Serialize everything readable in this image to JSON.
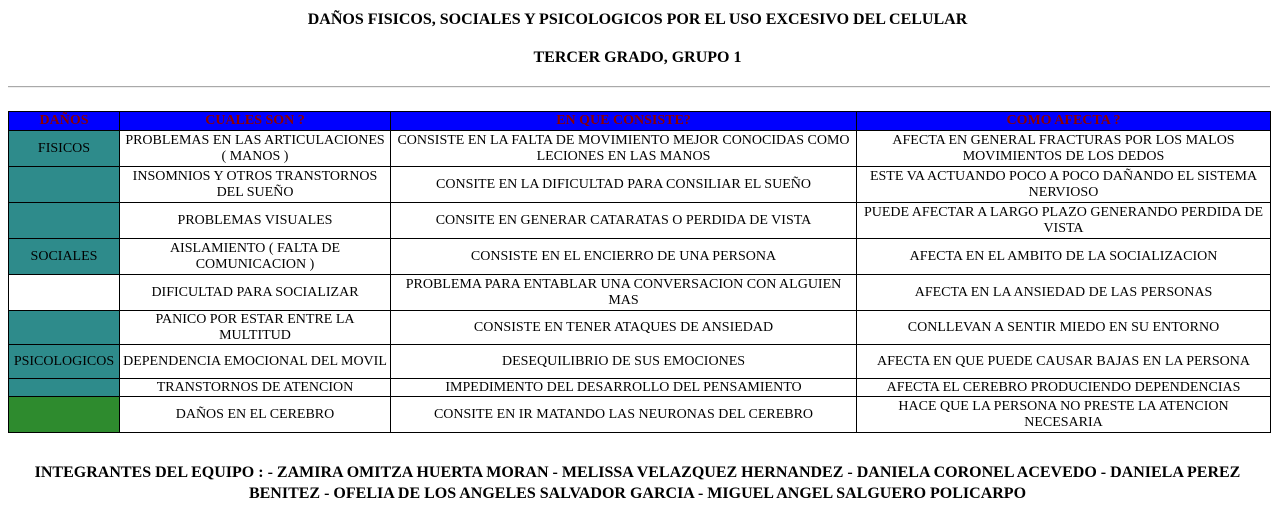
{
  "title": "DAÑOS FISICOS, SOCIALES Y PSICOLOGICOS POR EL USO EXCESIVO DEL CELULAR",
  "subtitle": "TERCER GRADO, GRUPO 1",
  "colors": {
    "header_bg": "#0000ff",
    "header_text": "#8b0000",
    "teal": "#2e8b8b",
    "green": "#2e8b2e",
    "white": "#ffffff"
  },
  "table": {
    "headers": [
      "DAÑOS",
      "CUALES SON ?",
      "EN QUE CONSISTE?",
      "COMO AFECTA ?"
    ],
    "rows": [
      {
        "category": "FISICOS",
        "cat_color": "teal",
        "cual": "PROBLEMAS EN LAS ARTICULACIONES ( MANOS )",
        "consiste": "CONSISTE EN LA FALTA DE MOVIMIENTO MEJOR CONOCIDAS COMO LECIONES EN LAS MANOS",
        "afecta": "AFECTA EN GENERAL FRACTURAS POR LOS MALOS MOVIMIENTOS DE LOS DEDOS"
      },
      {
        "category": "",
        "cat_color": "teal",
        "cual": "INSOMNIOS Y OTROS TRANSTORNOS DEL SUEÑO",
        "consiste": "CONSITE EN LA DIFICULTAD PARA CONSILIAR EL SUEÑO",
        "afecta": "ESTE VA ACTUANDO POCO A POCO DAÑANDO EL SISTEMA NERVIOSO"
      },
      {
        "category": "",
        "cat_color": "teal",
        "cual": "PROBLEMAS VISUALES",
        "consiste": "CONSITE EN GENERAR CATARATAS O PERDIDA DE VISTA",
        "afecta": "PUEDE AFECTAR A LARGO PLAZO GENERANDO PERDIDA DE VISTA"
      },
      {
        "category": "SOCIALES",
        "cat_color": "teal",
        "cual": "AISLAMIENTO ( FALTA DE COMUNICACION )",
        "consiste": "CONSISTE EN EL ENCIERRO DE UNA PERSONA",
        "afecta": "AFECTA EN EL AMBITO DE LA SOCIALIZACION"
      },
      {
        "category": "",
        "cat_color": "white",
        "cual": "DIFICULTAD PARA SOCIALIZAR",
        "consiste": "PROBLEMA PARA ENTABLAR UNA CONVERSACION CON ALGUIEN MAS",
        "afecta": "AFECTA EN LA ANSIEDAD DE LAS PERSONAS"
      },
      {
        "category": "",
        "cat_color": "teal",
        "cual": "PANICO POR ESTAR ENTRE LA MULTITUD",
        "consiste": "CONSISTE EN TENER ATAQUES DE ANSIEDAD",
        "afecta": "CONLLEVAN A SENTIR MIEDO EN SU ENTORNO"
      },
      {
        "category": "PSICOLOGICOS",
        "cat_color": "teal",
        "cual": "DEPENDENCIA EMOCIONAL DEL MOVIL",
        "consiste": "DESEQUILIBRIO DE SUS EMOCIONES",
        "afecta": "AFECTA EN QUE PUEDE CAUSAR BAJAS EN LA PERSONA"
      },
      {
        "category": "",
        "cat_color": "teal",
        "cual": "TRANSTORNOS DE ATENCION",
        "consiste": "IMPEDIMENTO DEL DESARROLLO DEL PENSAMIENTO",
        "afecta": "AFECTA EL CEREBRO PRODUCIENDO DEPENDENCIAS"
      },
      {
        "category": "",
        "cat_color": "green",
        "cual": "DAÑOS EN EL CEREBRO",
        "consiste": "CONSITE EN IR MATANDO LAS NEURONAS DEL CEREBRO",
        "afecta": "HACE QUE LA PERSONA NO PRESTE LA ATENCION NECESARIA"
      }
    ]
  },
  "footer": "INTEGRANTES DEL EQUIPO : - ZAMIRA OMITZA HUERTA MORAN - MELISSA VELAZQUEZ HERNANDEZ - DANIELA CORONEL ACEVEDO - DANIELA PEREZ BENITEZ - OFELIA DE LOS ANGELES SALVADOR GARCIA - MIGUEL ANGEL SALGUERO POLICARPO"
}
